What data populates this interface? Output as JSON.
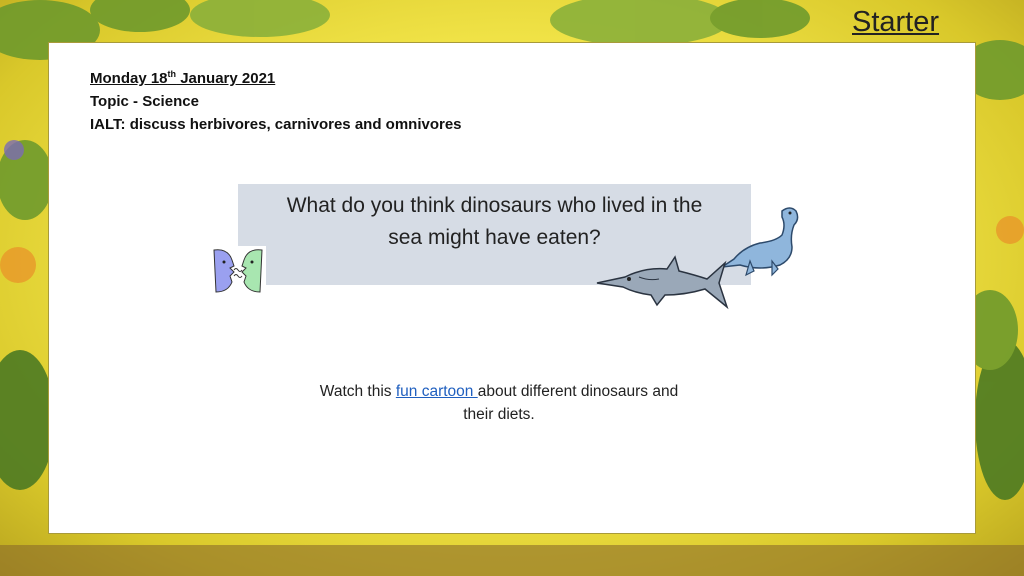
{
  "slide_title": "Starter",
  "header": {
    "date_prefix": "Monday 18",
    "date_sup": "th",
    "date_suffix": " January 2021",
    "topic": "Topic - Science",
    "ialt": "IALT: discuss herbivores, carnivores and omnivores"
  },
  "question": {
    "line1": "What do you think dinosaurs who lived in the",
    "line2": "sea might have eaten?"
  },
  "watch": {
    "before": "Watch this ",
    "link": "fun cartoon ",
    "after": "about different dinosaurs and",
    "line2": "their diets."
  },
  "colors": {
    "question_bg": "#d6dce5",
    "link": "#1f5fbf",
    "dino_blue": "#8fb6dc",
    "dino_gray": "#9aa8b8"
  },
  "icons": [
    "talking-faces-icon",
    "plesiosaur-icon",
    "ichthyosaur-icon"
  ]
}
